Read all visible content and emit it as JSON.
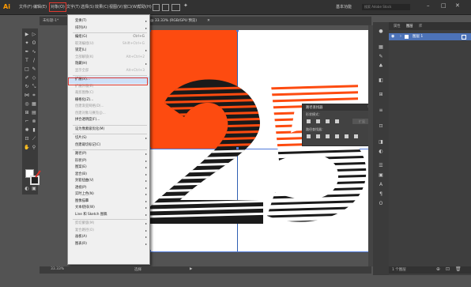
{
  "app": {
    "logo": "Ai",
    "menus": [
      "文件(F)",
      "编辑(E)",
      "对象(O)",
      "文字(T)",
      "选择(S)",
      "效果(C)",
      "视图(V)",
      "窗口(W)",
      "帮助(H)"
    ],
    "workspace_label": "基本功能",
    "search_placeholder": "搜索 Adobe Stock"
  },
  "document": {
    "tab_left": "未标题-1*",
    "tab_active": "@ 33.33% (RGB/GPU 预览)",
    "zoom_status": "33.33%",
    "artboard_label": "选择"
  },
  "object_menu": {
    "items": [
      {
        "label": "变换(T)",
        "shortcut": "",
        "arrow": "▸",
        "disabled": false
      },
      {
        "label": "排列(A)",
        "shortcut": "",
        "arrow": "▸",
        "disabled": false
      },
      {
        "label": "",
        "sep": true
      },
      {
        "label": "编组(G)",
        "shortcut": "Ctrl+G",
        "arrow": "",
        "disabled": false
      },
      {
        "label": "取消编组(U)",
        "shortcut": "Shift+Ctrl+G",
        "arrow": "",
        "disabled": true
      },
      {
        "label": "锁定(L)",
        "shortcut": "",
        "arrow": "▸",
        "disabled": false
      },
      {
        "label": "全部解锁(K)",
        "shortcut": "Alt+Ctrl+2",
        "arrow": "",
        "disabled": true
      },
      {
        "label": "隐藏(H)",
        "shortcut": "",
        "arrow": "▸",
        "disabled": false
      },
      {
        "label": "显示全部",
        "shortcut": "Alt+Ctrl+3",
        "arrow": "",
        "disabled": true
      },
      {
        "label": "",
        "sep": true
      },
      {
        "label": "扩展(X)...",
        "shortcut": "",
        "arrow": "",
        "disabled": false,
        "highlight": true
      },
      {
        "label": "扩展外观(E)",
        "shortcut": "",
        "arrow": "",
        "disabled": true
      },
      {
        "label": "裁剪图像(C)",
        "shortcut": "",
        "arrow": "",
        "disabled": true
      },
      {
        "label": "栅格化(Z)...",
        "shortcut": "",
        "arrow": "",
        "disabled": false
      },
      {
        "label": "创建渐变网格(D)...",
        "shortcut": "",
        "arrow": "",
        "disabled": true
      },
      {
        "label": "创建对象马赛克(J)...",
        "shortcut": "",
        "arrow": "",
        "disabled": true
      },
      {
        "label": "拼合透明度(F)...",
        "shortcut": "",
        "arrow": "",
        "disabled": false
      },
      {
        "label": "",
        "sep": true
      },
      {
        "label": "设为像素级优化(M)",
        "shortcut": "",
        "arrow": "",
        "disabled": false
      },
      {
        "label": "",
        "sep": true
      },
      {
        "label": "切片(S)",
        "shortcut": "",
        "arrow": "▸",
        "disabled": false
      },
      {
        "label": "创建裁切标记(C)",
        "shortcut": "",
        "arrow": "",
        "disabled": false
      },
      {
        "label": "",
        "sep": true
      },
      {
        "label": "路径(P)",
        "shortcut": "",
        "arrow": "▸",
        "disabled": false
      },
      {
        "label": "形状(P)",
        "shortcut": "",
        "arrow": "▸",
        "disabled": false
      },
      {
        "label": "图案(E)",
        "shortcut": "",
        "arrow": "▸",
        "disabled": false
      },
      {
        "label": "混合(B)",
        "shortcut": "",
        "arrow": "▸",
        "disabled": false
      },
      {
        "label": "封套扭曲(V)",
        "shortcut": "",
        "arrow": "▸",
        "disabled": false
      },
      {
        "label": "透视(P)",
        "shortcut": "",
        "arrow": "▸",
        "disabled": false
      },
      {
        "label": "实时上色(N)",
        "shortcut": "",
        "arrow": "▸",
        "disabled": false
      },
      {
        "label": "图像描摹",
        "shortcut": "",
        "arrow": "▸",
        "disabled": false
      },
      {
        "label": "文本绕排(W)",
        "shortcut": "",
        "arrow": "▸",
        "disabled": false
      },
      {
        "label": "Line 和 Sketch 图稿",
        "shortcut": "",
        "arrow": "▸",
        "disabled": false
      },
      {
        "label": "",
        "sep": true
      },
      {
        "label": "剪切蒙版(M)",
        "shortcut": "",
        "arrow": "▸",
        "disabled": true
      },
      {
        "label": "复合路径(O)",
        "shortcut": "",
        "arrow": "▸",
        "disabled": true
      },
      {
        "label": "画板(A)",
        "shortcut": "",
        "arrow": "▸",
        "disabled": false
      },
      {
        "label": "图表(R)",
        "shortcut": "",
        "arrow": "▸",
        "disabled": false
      }
    ]
  },
  "pathfinder": {
    "title": "路径查找器",
    "shape_modes_label": "形状模式：",
    "pathfinders_label": "路径查找器：",
    "expand_label": "扩展"
  },
  "layers": {
    "tab_labels": [
      "属性",
      "图层",
      "库"
    ],
    "layer_name": "图层 1",
    "footer_label": "1 个图层"
  },
  "artwork_text": "25",
  "colors": {
    "accent": "#fd4b10",
    "menu_highlight": "#cfe0f7",
    "guide_blue": "#4f79d9",
    "highlight_border": "#e13a30"
  }
}
